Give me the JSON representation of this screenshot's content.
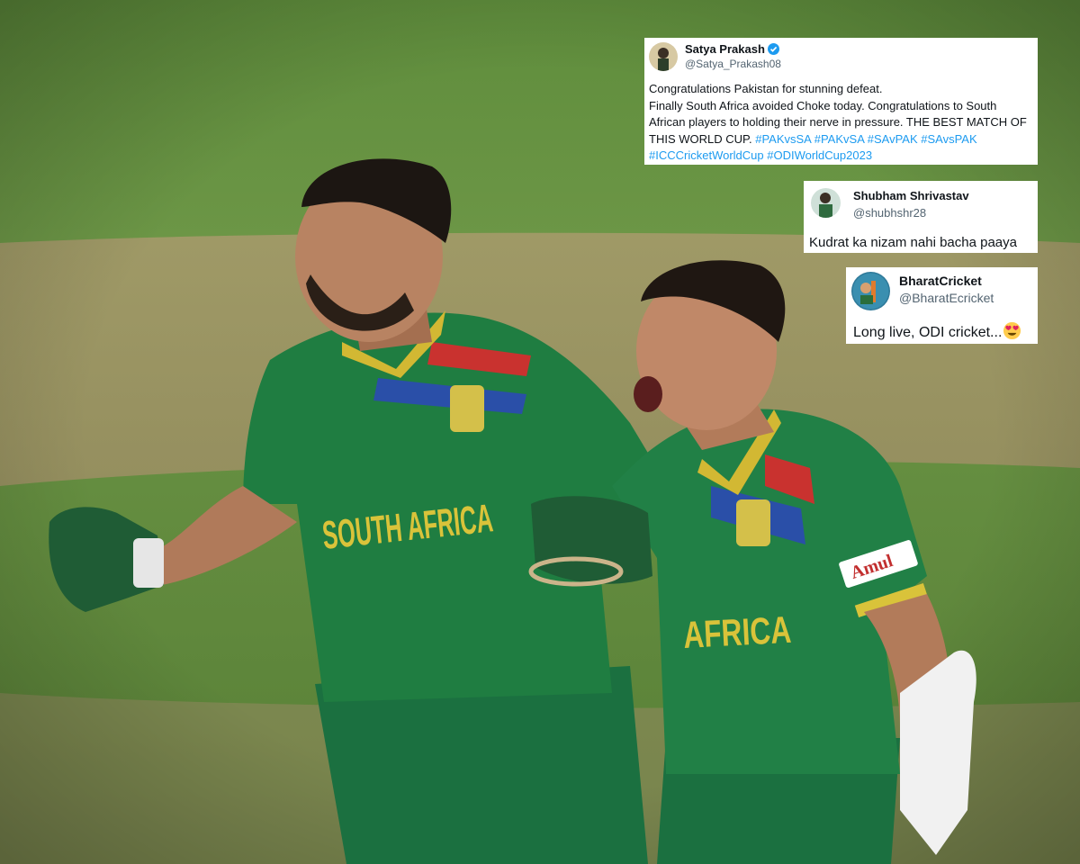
{
  "tweets": [
    {
      "name": "Satya Prakash",
      "verified": true,
      "handle": "@Satya_Prakash08",
      "text_lines": [
        "Congratulations Pakistan for stunning defeat.",
        "Finally South Africa avoided Choke today. Congratulations to South",
        "African players to holding their nerve in pressure. THE BEST MATCH OF"
      ],
      "last_line_text": "THIS WORLD CUP.",
      "hashtags_line1": "#PAKvsSA #PAKvSA #SAvPAK #SAvsPAK",
      "hashtags_line2": "#ICCCricketWorldCup #ODIWorldCup2023"
    },
    {
      "name": "Shubham Shrivastav",
      "handle": "@shubhshr28",
      "text": "Kudrat ka nizam nahi bacha paaya"
    },
    {
      "name": "BharatCricket",
      "handle": "@BharatEcricket",
      "text": "Long live, ODI cricket...",
      "emoji": "heart-eyes-emoji"
    }
  ],
  "jersey_text": {
    "left_player": "SOUTH AFRICA",
    "right_player": "AFRICA",
    "sponsor": "Amul"
  },
  "colors": {
    "pitch_green": "#5c8a3a",
    "jersey_green": "#1d7a3f",
    "jersey_yellow": "#d9c33a",
    "link_blue": "#1d9bf0"
  }
}
